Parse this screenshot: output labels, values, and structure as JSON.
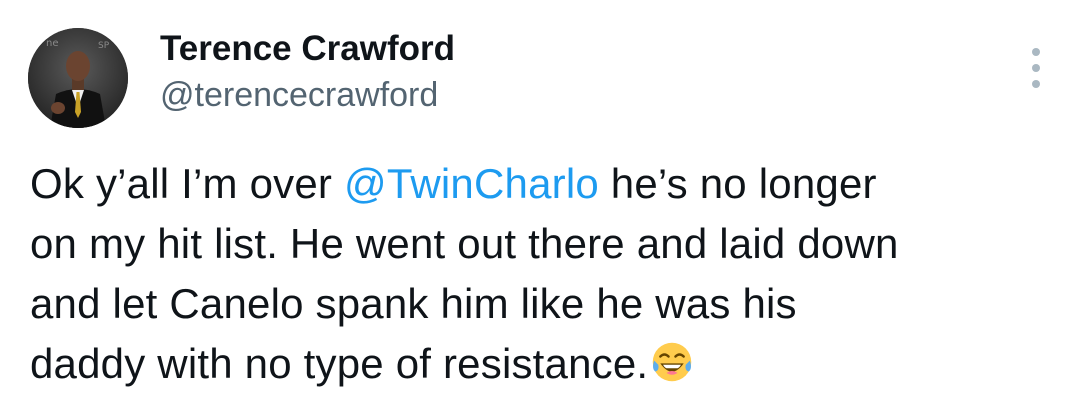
{
  "tweet": {
    "author": {
      "display_name": "Terence Crawford",
      "handle": "@terencecrawford",
      "avatar_icon": "profile-photo"
    },
    "more_icon": "more-options-vertical-icon",
    "text": {
      "line1_before": "Ok y’all I’m over ",
      "mention": "@TwinCharlo",
      "line1_after": " he’s no longer",
      "line2": "on my hit list. He went out there and laid down",
      "line3": "and let Canelo spank him like he was his",
      "line4": "daddy with no type of resistance.",
      "emoji": "face-with-tears-of-joy-icon"
    },
    "colors": {
      "text": "#0f1419",
      "handle": "#536471",
      "mention": "#1d9bf0",
      "more_dots": "#aab8c2"
    }
  }
}
